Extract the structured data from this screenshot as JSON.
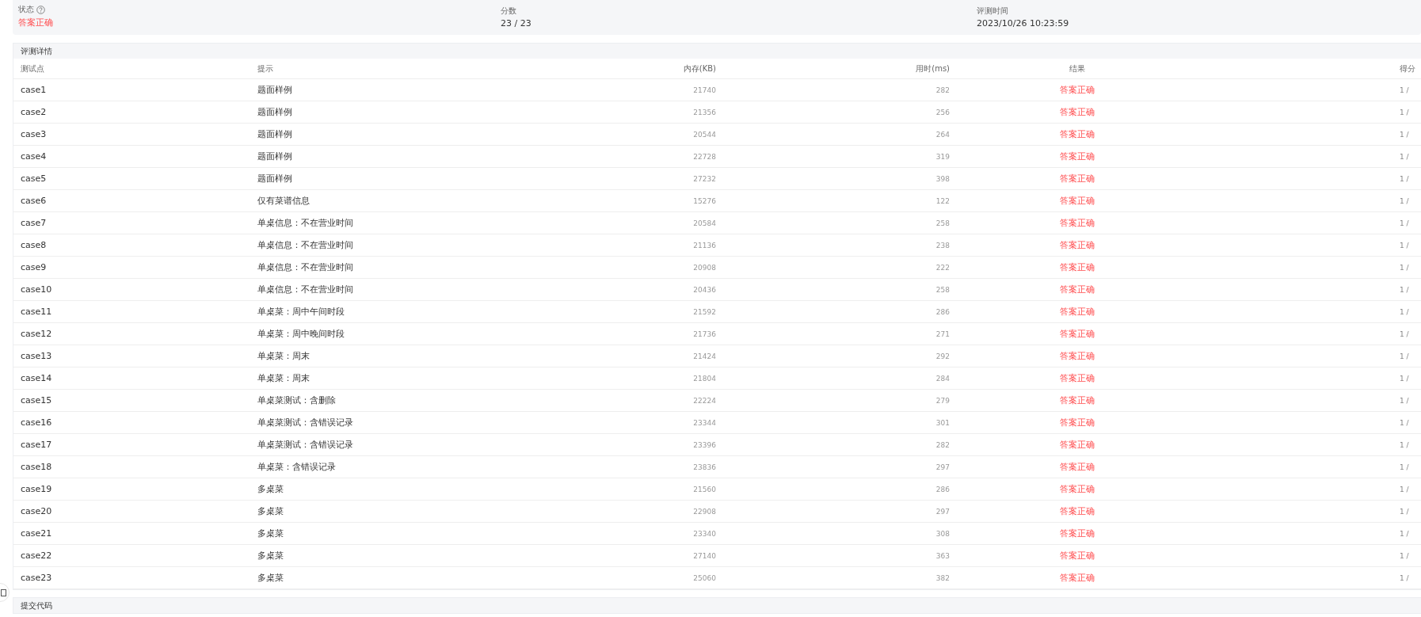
{
  "summary": [
    {
      "label": "状态",
      "help": true,
      "value": "答案正确",
      "kind": "status"
    },
    {
      "label": "分数",
      "help": false,
      "value": "23 / 23",
      "kind": "plain"
    },
    {
      "label": "评测时间",
      "help": false,
      "value": "2023/10/26 10:23:59",
      "kind": "plain"
    }
  ],
  "details": {
    "title": "评测详情",
    "columns": [
      "测试点",
      "提示",
      "内存(KB)",
      "用时(ms)",
      "结果",
      "得分"
    ],
    "rows": [
      {
        "case": "case1",
        "hint": "题面样例",
        "memory": "21740",
        "time": "282",
        "result": "答案正确",
        "score": "1 /"
      },
      {
        "case": "case2",
        "hint": "题面样例",
        "memory": "21356",
        "time": "256",
        "result": "答案正确",
        "score": "1 /"
      },
      {
        "case": "case3",
        "hint": "题面样例",
        "memory": "20544",
        "time": "264",
        "result": "答案正确",
        "score": "1 /"
      },
      {
        "case": "case4",
        "hint": "题面样例",
        "memory": "22728",
        "time": "319",
        "result": "答案正确",
        "score": "1 /"
      },
      {
        "case": "case5",
        "hint": "题面样例",
        "memory": "27232",
        "time": "398",
        "result": "答案正确",
        "score": "1 /"
      },
      {
        "case": "case6",
        "hint": "仅有菜谱信息",
        "memory": "15276",
        "time": "122",
        "result": "答案正确",
        "score": "1 /"
      },
      {
        "case": "case7",
        "hint": "单桌信息：不在营业时间",
        "memory": "20584",
        "time": "258",
        "result": "答案正确",
        "score": "1 /"
      },
      {
        "case": "case8",
        "hint": "单桌信息：不在营业时间",
        "memory": "21136",
        "time": "238",
        "result": "答案正确",
        "score": "1 /"
      },
      {
        "case": "case9",
        "hint": "单桌信息：不在营业时间",
        "memory": "20908",
        "time": "222",
        "result": "答案正确",
        "score": "1 /"
      },
      {
        "case": "case10",
        "hint": "单桌信息：不在营业时间",
        "memory": "20436",
        "time": "258",
        "result": "答案正确",
        "score": "1 /"
      },
      {
        "case": "case11",
        "hint": "单桌菜：周中午间时段",
        "memory": "21592",
        "time": "286",
        "result": "答案正确",
        "score": "1 /"
      },
      {
        "case": "case12",
        "hint": "单桌菜：周中晚间时段",
        "memory": "21736",
        "time": "271",
        "result": "答案正确",
        "score": "1 /"
      },
      {
        "case": "case13",
        "hint": "单桌菜：周末",
        "memory": "21424",
        "time": "292",
        "result": "答案正确",
        "score": "1 /"
      },
      {
        "case": "case14",
        "hint": "单桌菜：周末",
        "memory": "21804",
        "time": "284",
        "result": "答案正确",
        "score": "1 /"
      },
      {
        "case": "case15",
        "hint": "单桌菜测试：含删除",
        "memory": "22224",
        "time": "279",
        "result": "答案正确",
        "score": "1 /"
      },
      {
        "case": "case16",
        "hint": "单桌菜测试：含错误记录",
        "memory": "23344",
        "time": "301",
        "result": "答案正确",
        "score": "1 /"
      },
      {
        "case": "case17",
        "hint": "单桌菜测试：含错误记录",
        "memory": "23396",
        "time": "282",
        "result": "答案正确",
        "score": "1 /"
      },
      {
        "case": "case18",
        "hint": "单桌菜：含错误记录",
        "memory": "23836",
        "time": "297",
        "result": "答案正确",
        "score": "1 /"
      },
      {
        "case": "case19",
        "hint": "多桌菜",
        "memory": "21560",
        "time": "286",
        "result": "答案正确",
        "score": "1 /"
      },
      {
        "case": "case20",
        "hint": "多桌菜",
        "memory": "22908",
        "time": "297",
        "result": "答案正确",
        "score": "1 /"
      },
      {
        "case": "case21",
        "hint": "多桌菜",
        "memory": "23340",
        "time": "308",
        "result": "答案正确",
        "score": "1 /"
      },
      {
        "case": "case22",
        "hint": "多桌菜",
        "memory": "27140",
        "time": "363",
        "result": "答案正确",
        "score": "1 /"
      },
      {
        "case": "case23",
        "hint": "多桌菜",
        "memory": "25060",
        "time": "382",
        "result": "答案正确",
        "score": "1 /"
      }
    ]
  },
  "code_section": {
    "title": "提交代码"
  }
}
